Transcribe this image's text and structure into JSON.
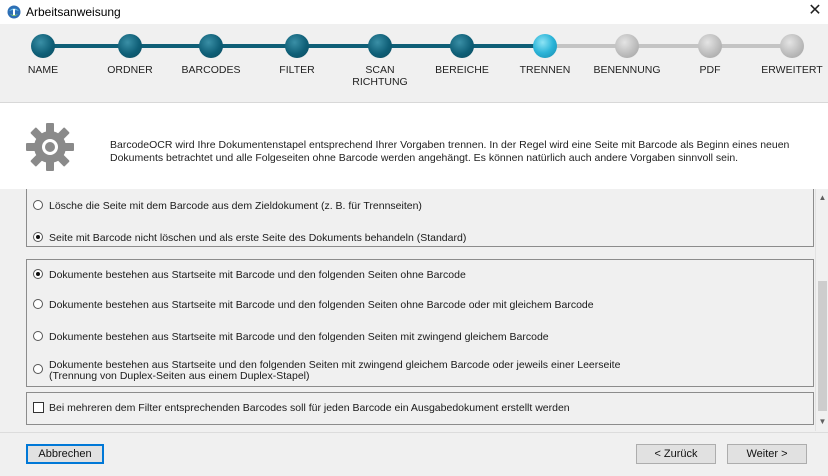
{
  "window": {
    "title": "Arbeitsanweisung",
    "close_glyph": "✕"
  },
  "steps": [
    {
      "label": "NAME",
      "state": "done"
    },
    {
      "label": "ORDNER",
      "state": "done"
    },
    {
      "label": "BARCODES",
      "state": "done"
    },
    {
      "label": "FILTER",
      "state": "done"
    },
    {
      "label": "SCAN\nRICHTUNG",
      "state": "done"
    },
    {
      "label": "BEREICHE",
      "state": "done"
    },
    {
      "label": "TRENNEN",
      "state": "current"
    },
    {
      "label": "BENENNUNG",
      "state": "todo"
    },
    {
      "label": "PDF",
      "state": "todo"
    },
    {
      "label": "ERWEITERT",
      "state": "todo"
    }
  ],
  "info": {
    "icon": "gear-icon",
    "text": "BarcodeOCR wird Ihre Dokumentenstapel entsprechend Ihrer Vorgaben trennen. In der Regel wird eine Seite mit Barcode als Beginn eines neuen Dokuments betrachtet und alle Folgeseiten ohne Barcode werden angehängt. Es können natürlich auch andere Vorgaben sinnvoll sein."
  },
  "group1": {
    "options": [
      {
        "label": "Lösche die Seite mit dem Barcode aus dem Zieldokument (z. B. für Trennseiten)",
        "selected": false
      },
      {
        "label": "Seite mit Barcode nicht löschen und als erste Seite des Dokuments behandeln (Standard)",
        "selected": true
      }
    ]
  },
  "group2": {
    "options": [
      {
        "label": "Dokumente bestehen aus Startseite mit Barcode und den folgenden Seiten ohne Barcode",
        "selected": true
      },
      {
        "label": "Dokumente bestehen aus Startseite mit Barcode und den folgenden Seiten ohne Barcode oder mit gleichem Barcode",
        "selected": false
      },
      {
        "label": "Dokumente bestehen aus Startseite mit Barcode und den folgenden Seiten mit zwingend gleichem Barcode",
        "selected": false
      },
      {
        "label": "Dokumente bestehen aus Startseite und den folgenden Seiten mit zwingend gleichem Barcode oder jeweils einer Leerseite",
        "label2": "(Trennung von Duplex-Seiten aus einem Duplex-Stapel)",
        "selected": false
      }
    ]
  },
  "group3": {
    "checkbox": {
      "label": "Bei mehreren dem Filter entsprechenden Barcodes soll für jeden Barcode ein Ausgabedokument erstellt werden",
      "checked": false
    }
  },
  "scrollbar": {
    "up": "▲",
    "down": "▼"
  },
  "footer": {
    "cancel": "Abbrechen",
    "back": "< Zurück",
    "next": "Weiter >"
  },
  "colors": {
    "step_done": "#0f5f77",
    "step_current": "#2bb4d8",
    "step_todo": "#b0b0b0",
    "track_done": "#0f5f77",
    "track_todo": "#c4c4c4",
    "primary_border": "#0078d7"
  }
}
